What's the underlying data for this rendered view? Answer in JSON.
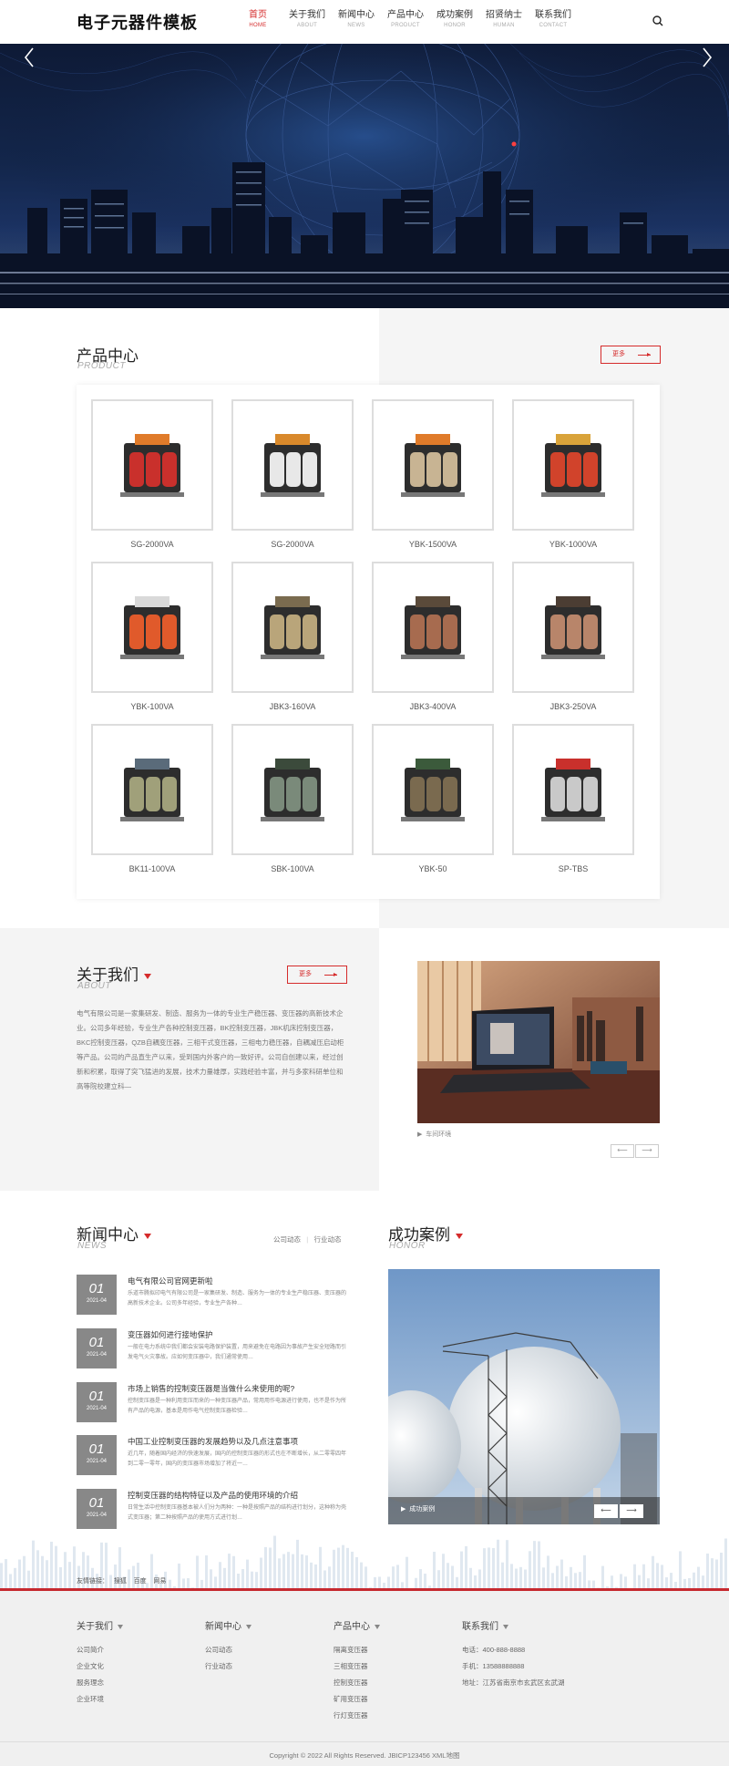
{
  "header": {
    "logo": "电子元器件模板",
    "nav": [
      {
        "cn": "首页",
        "en": "HOME",
        "active": true
      },
      {
        "cn": "关于我们",
        "en": "ABOUT"
      },
      {
        "cn": "新闻中心",
        "en": "NEWS"
      },
      {
        "cn": "产品中心",
        "en": "PRODUCT"
      },
      {
        "cn": "成功案例",
        "en": "HONOR"
      },
      {
        "cn": "招贤纳士",
        "en": "HUMAN"
      },
      {
        "cn": "联系我们",
        "en": "CONTACT"
      }
    ]
  },
  "products": {
    "title": "产品中心",
    "title_en": "PRODUCT",
    "more": "更多",
    "items": [
      "SG-2000VA",
      "SG-2000VA",
      "YBK-1500VA",
      "YBK-1000VA",
      "YBK-100VA",
      "JBK3-160VA",
      "JBK3-400VA",
      "JBK3-250VA",
      "BK11-100VA",
      "SBK-100VA",
      "YBK-50",
      "SP-TBS"
    ]
  },
  "about": {
    "title": "关于我们",
    "title_en": "ABOUT",
    "more": "更多",
    "text": "电气有限公司是一家集研发、制造、服务为一体的专业生产稳压器、变压器的高新技术企业。公司多年经验，专业生产各种控制变压器，BK控制变压器，JBK机床控制变压器，BKC控制变压器，QZB自耦变压器，三相干式变压器，三相电力稳压器，自耦减压启动柜等产品。公司的产品直生产以来，受到国内外客户的一致好评。公司自创建以来，经过创新和积累，取得了突飞猛进的发展，技术力量雄厚，实践经验丰富，并与多家科研单位和高等院校建立科—",
    "caption": "车间环境",
    "prev": "⟵",
    "next": "⟶"
  },
  "news": {
    "title": "新闻中心",
    "title_en": "NEWS",
    "tabs": [
      "公司动态",
      "行业动态"
    ],
    "separator": "|",
    "items": [
      {
        "day": "01",
        "ym": "2021-04",
        "title": "电气有限公司官网更新啦",
        "desc": "乐道市腾拟印电气有限公司是一家集研发、制造、服务为一体的专业生产稳压器、变压器的高新技术企业。公司多年经验，专业生产各种…"
      },
      {
        "day": "01",
        "ym": "2021-04",
        "title": "变压器如何进行接地保护",
        "desc": "一般在电力系统中我们都会安装电路保护装置，用来避免在电路因为事故产生安全短路而引发电气火灾事故。应如何变压器中，我们通常使用…"
      },
      {
        "day": "01",
        "ym": "2021-04",
        "title": "市场上销售的控制变压器是当做什么来使用的呢?",
        "desc": "控制变压器是一种利用变压而来的一种变压器产品，常用用作电源进行使用，也不是作为所有产品的电源，基本是用作电气控制变压器检验…"
      },
      {
        "day": "01",
        "ym": "2021-04",
        "title": "中国工业控制变压器的发展趋势以及几点注意事项",
        "desc": "近几年，随着国内经济的快速发展，国内的控制变压器的形式也在不断增长，从二零零四年到二零一零年，国内的变压器市场增加了将近一…"
      },
      {
        "day": "01",
        "ym": "2021-04",
        "title": "控制变压器的结构特征以及产品的使用环境的介绍",
        "desc": "日常生活中控制变压器基本被人们分为两种：一种是按照产品的结构进行划分，这种称为壳式变压器；第二种按照产品的使用方式进行划…"
      }
    ]
  },
  "cases": {
    "title": "成功案例",
    "title_en": "HONOR",
    "caption": "成功案例",
    "prev": "⟵",
    "next": "⟶"
  },
  "footer": {
    "links_label": "友情链接：",
    "links": [
      "搜狐",
      "百度",
      "网易"
    ],
    "columns": [
      {
        "title": "关于我们",
        "items": [
          "公司简介",
          "企业文化",
          "服务理念",
          "企业环境"
        ]
      },
      {
        "title": "新闻中心",
        "items": [
          "公司动态",
          "行业动态"
        ]
      },
      {
        "title": "产品中心",
        "items": [
          "隔离变压器",
          "三相变压器",
          "控制变压器",
          "矿用变压器",
          "行灯变压器"
        ]
      },
      {
        "title": "联系我们",
        "items": [
          "电话：400-888-8888",
          "手机：13588888888",
          "地址：江苏省南京市玄武区玄武湖"
        ]
      }
    ],
    "copyright": "Copyright © 2022 All Rights Reserved.   JBICP123456   XML地图"
  },
  "colors": {
    "accent": "#d52b2b",
    "footer_border": "#c6292f",
    "date_box": "#888888"
  }
}
